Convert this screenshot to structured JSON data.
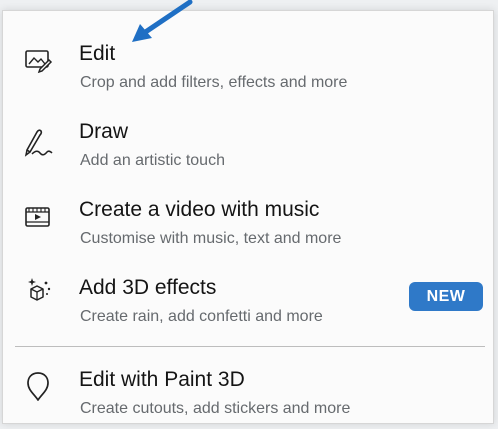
{
  "menu": {
    "items": [
      {
        "title": "Edit",
        "description": "Crop and add filters, effects and more",
        "icon": "edit-photo-icon"
      },
      {
        "title": "Draw",
        "description": "Add an artistic touch",
        "icon": "pen-draw-icon"
      },
      {
        "title": "Create a video with music",
        "description": "Customise with music, text and more",
        "icon": "video-clip-icon"
      },
      {
        "title": "Add 3D effects",
        "description": "Create rain, add confetti and more",
        "icon": "3d-effects-icon",
        "badge": "NEW"
      },
      {
        "title": "Edit with Paint 3D",
        "description": "Create cutouts, add stickers and more",
        "icon": "paint-3d-icon"
      }
    ]
  },
  "colors": {
    "badge_bg": "#2f79c8",
    "arrow": "#1f6fc4",
    "title_text": "#141414",
    "description_text": "#666a6e"
  }
}
